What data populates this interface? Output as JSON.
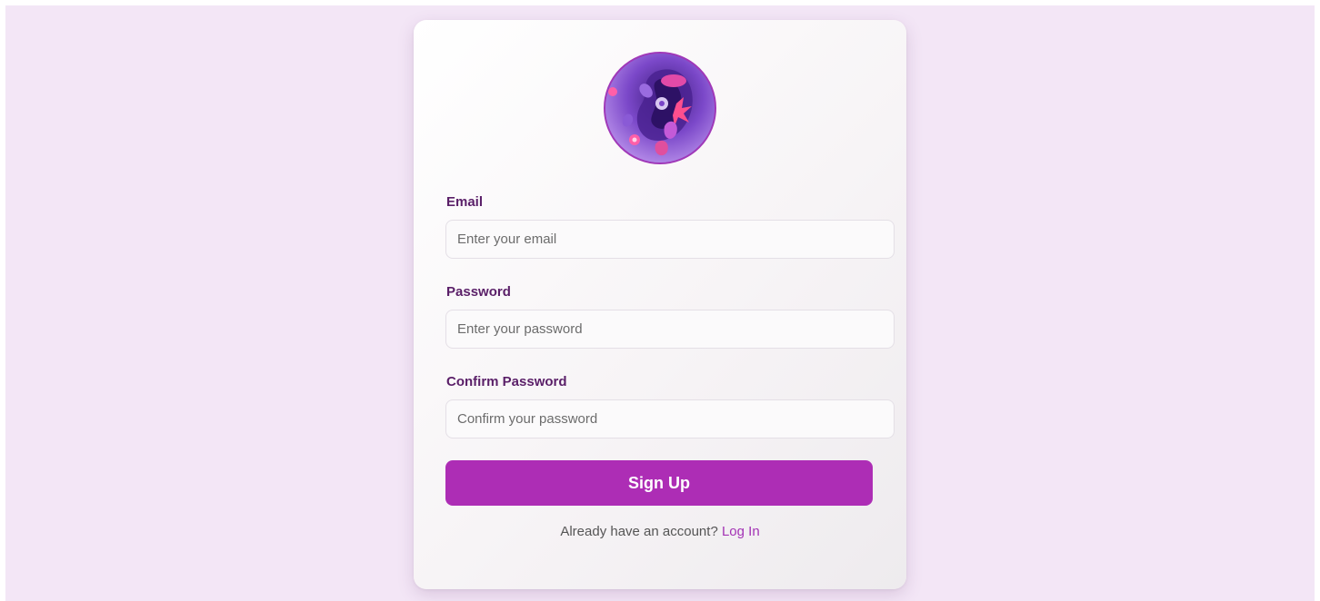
{
  "form": {
    "avatar_icon": "floral-paper-art-avatar",
    "email": {
      "label": "Email",
      "placeholder": "Enter your email",
      "value": ""
    },
    "password": {
      "label": "Password",
      "placeholder": "Enter your password",
      "value": ""
    },
    "confirm_password": {
      "label": "Confirm Password",
      "placeholder": "Confirm your password",
      "value": ""
    },
    "submit_label": "Sign Up",
    "login_prompt_text": "Already have an account?",
    "login_link_label": "Log In"
  },
  "colors": {
    "page_background": "#f3e6f6",
    "card_background": "#ffffff",
    "label_color": "#5a1f68",
    "button_color": "#ad2db5",
    "link_color": "#a333b5"
  }
}
